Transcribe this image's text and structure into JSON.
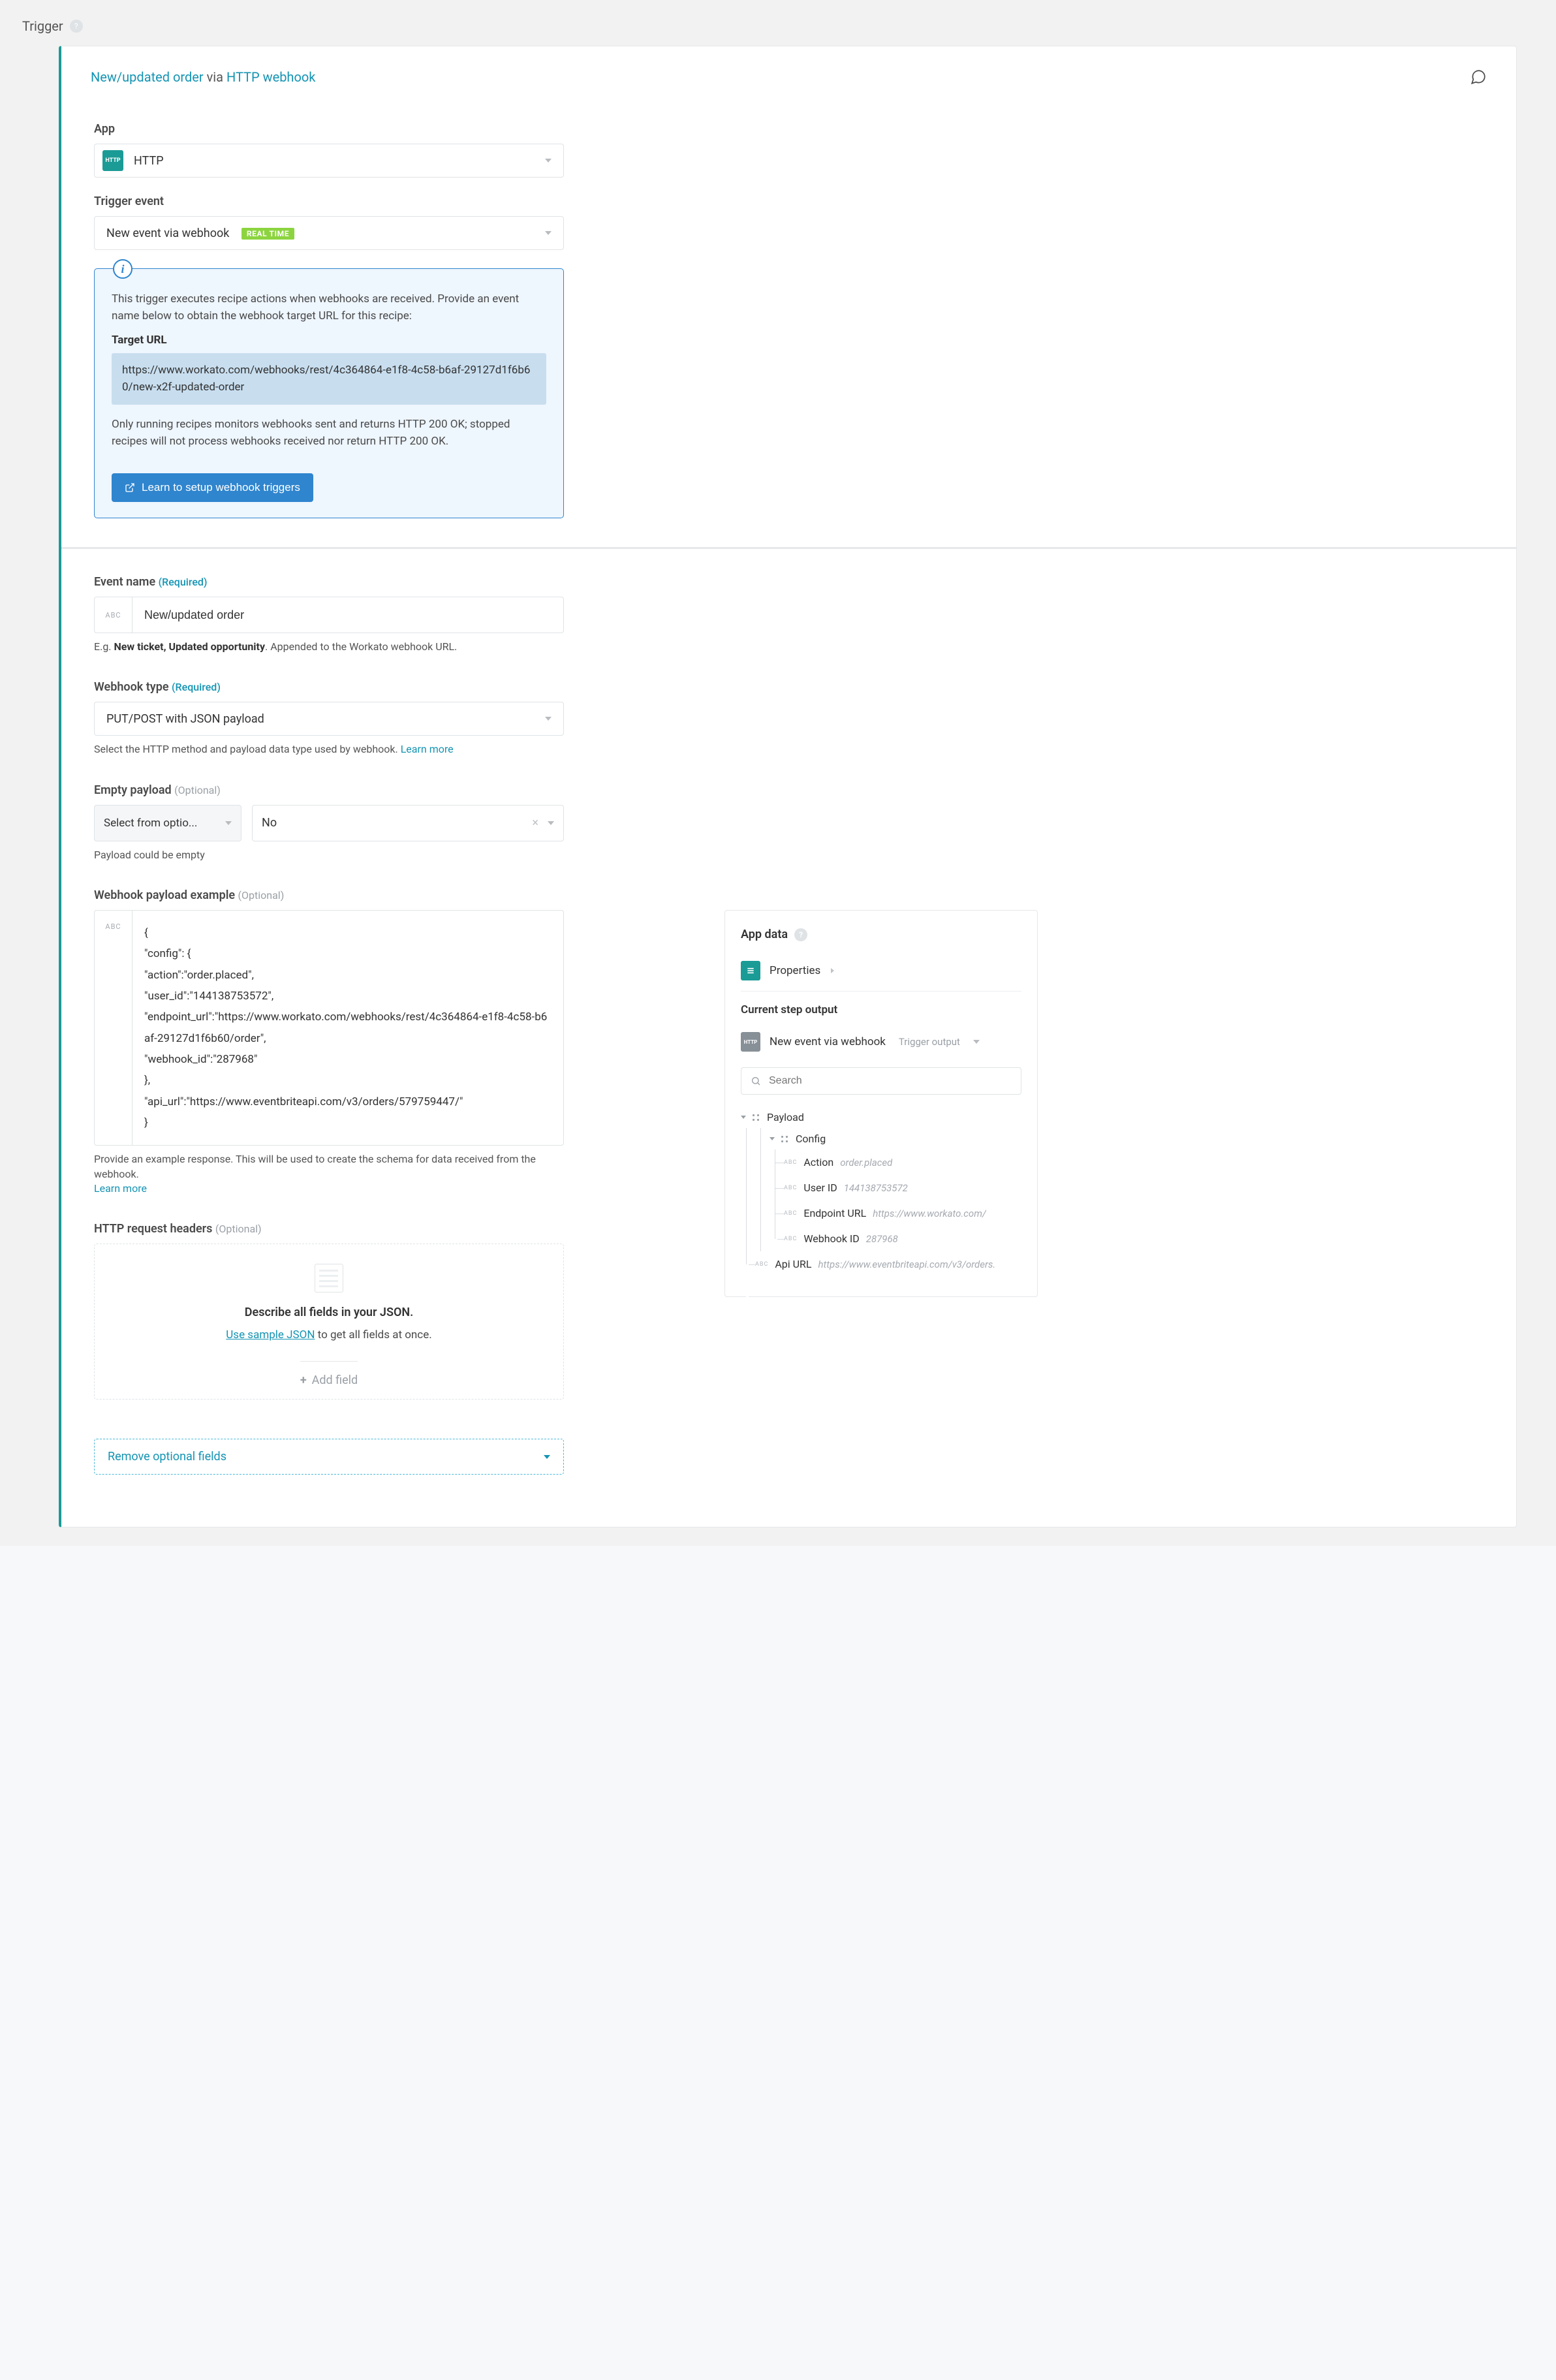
{
  "section_title": "Trigger",
  "header": {
    "crumb_link1": "New/updated order",
    "crumb_via": " via ",
    "crumb_link2": "HTTP webhook"
  },
  "fields": {
    "app": {
      "label": "App",
      "value": "HTTP",
      "badge_text": "HTTP"
    },
    "trigger_event": {
      "label": "Trigger event",
      "value": "New event via webhook",
      "realtime": "REAL TIME"
    },
    "info": {
      "p1": "This trigger executes recipe actions when webhooks are received. Provide an event name below to obtain the webhook target URL for this recipe:",
      "target_url_label": "Target URL",
      "target_url": "https://www.workato.com/webhooks/rest/4c364864-e1f8-4c58-b6af-29127d1f6b60/new-x2f-updated-order",
      "p2": "Only running recipes monitors webhooks sent and returns HTTP 200 OK; stopped recipes will not process webhooks received nor return HTTP 200 OK.",
      "learn_btn": "Learn to setup webhook triggers"
    },
    "event_name": {
      "label": "Event name",
      "required": "(Required)",
      "prefix": "ABC",
      "value": "New/updated order",
      "help_prefix": "E.g. ",
      "help_bold": "New ticket, Updated opportunity",
      "help_suffix": ". Appended to the Workato webhook URL."
    },
    "webhook_type": {
      "label": "Webhook type",
      "required": "(Required)",
      "value": "PUT/POST with JSON payload",
      "help": "Select the HTTP method and payload data type used by webhook. ",
      "learn_more": "Learn more"
    },
    "empty_payload": {
      "label": "Empty payload",
      "optional": "(Optional)",
      "left": "Select from optio...",
      "right": "No",
      "help": "Payload could be empty"
    },
    "payload_example": {
      "label": "Webhook payload example",
      "optional": "(Optional)",
      "prefix": "ABC",
      "value": "{\n\"config\": {\n\"action\":\"order.placed\",\n\"user_id\":\"144138753572\",\n\"endpoint_url\":\"https://www.workato.com/webhooks/rest/4c364864-e1f8-4c58-b6af-29127d1f6b60/order\",\n\"webhook_id\":\"287968\"\n},\n\"api_url\":\"https://www.eventbriteapi.com/v3/orders/579759447/\"\n}",
      "help": "Provide an example response. This will be used to create the schema for data received from the webhook. ",
      "learn_more": "Learn more"
    },
    "headers": {
      "label": "HTTP request headers",
      "optional": "(Optional)",
      "title": "Describe all fields in your JSON.",
      "sample_link": "Use sample JSON",
      "sample_suffix": " to get all fields at once.",
      "add_field": "Add field"
    },
    "remove": "Remove optional fields"
  },
  "right_panel": {
    "app_data": "App data",
    "properties": "Properties",
    "current_step": "Current step output",
    "step_name": "New event via webhook",
    "step_suffix": "Trigger output",
    "search_placeholder": "Search",
    "tree": {
      "payload": "Payload",
      "config": "Config",
      "leaves": [
        {
          "label": "Action",
          "value": "order.placed"
        },
        {
          "label": "User ID",
          "value": "144138753572"
        },
        {
          "label": "Endpoint URL",
          "value": "https://www.workato.com/"
        },
        {
          "label": "Webhook ID",
          "value": "287968"
        }
      ],
      "api_url": {
        "label": "Api URL",
        "value": "https://www.eventbriteapi.com/v3/orders."
      }
    }
  }
}
